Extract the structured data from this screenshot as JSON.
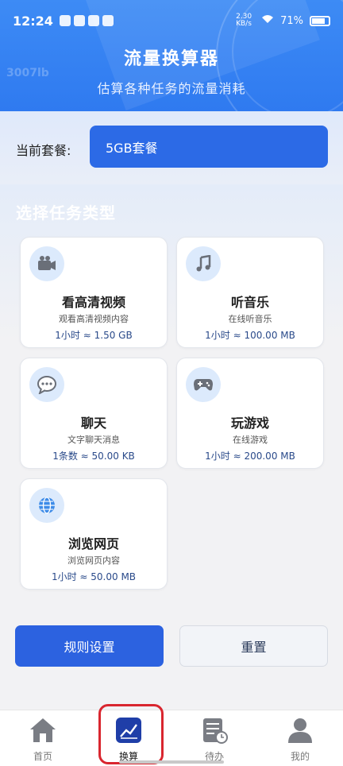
{
  "status_bar": {
    "time": "12:24",
    "net_speed": "2.30 KB/s",
    "battery": "71%"
  },
  "header": {
    "title": "流量换算器",
    "subtitle": "估算各种任务的流量消耗",
    "watermark": "3007lb"
  },
  "plan": {
    "label": "当前套餐:",
    "selected": "5GB套餐"
  },
  "tasks": {
    "section_title": "选择任务类型",
    "items": [
      {
        "icon": "video-camera-icon",
        "glyph": "📹",
        "title": "看高清视频",
        "desc": "观看高清视频内容",
        "rate": "1小时 ≈ 1.50 GB"
      },
      {
        "icon": "music-note-icon",
        "glyph": "🎵",
        "title": "听音乐",
        "desc": "在线听音乐",
        "rate": "1小时 ≈ 100.00 MB"
      },
      {
        "icon": "chat-bubble-icon",
        "glyph": "💬",
        "title": "聊天",
        "desc": "文字聊天消息",
        "rate": "1条数 ≈ 50.00 KB"
      },
      {
        "icon": "gamepad-icon",
        "glyph": "🎮",
        "title": "玩游戏",
        "desc": "在线游戏",
        "rate": "1小时 ≈ 200.00 MB"
      },
      {
        "icon": "globe-icon",
        "glyph": "🌐",
        "title": "浏览网页",
        "desc": "浏览网页内容",
        "rate": "1小时 ≈ 50.00 MB"
      }
    ]
  },
  "buttons": {
    "rules": "规则设置",
    "reset": "重置"
  },
  "nav": {
    "items": [
      {
        "label": "首页",
        "icon": "home-icon"
      },
      {
        "label": "换算",
        "icon": "chart-icon"
      },
      {
        "label": "待办",
        "icon": "todo-list-icon"
      },
      {
        "label": "我的",
        "icon": "user-icon"
      }
    ],
    "active_color": "#1f3ea8"
  }
}
